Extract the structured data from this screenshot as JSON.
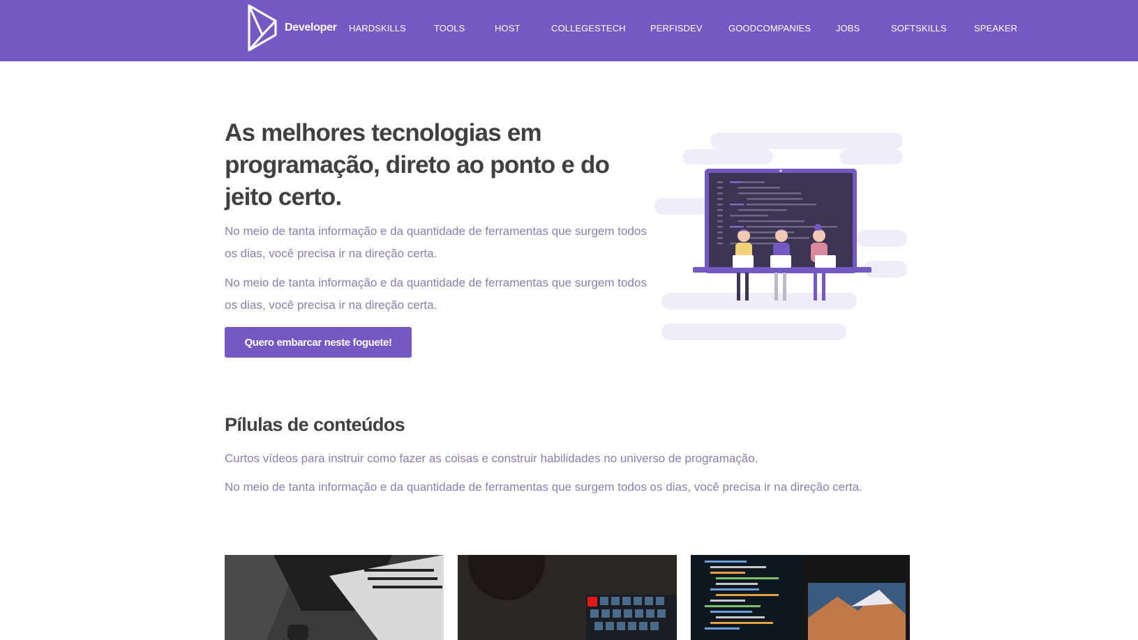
{
  "brand": {
    "name": "Developer"
  },
  "nav": {
    "items": [
      "HARDSKILLS",
      "TOOLS",
      "HOST",
      "COLLEGESTECH",
      "PERFISDEV",
      "GOODCOMPANIES",
      "JOBS",
      "SOFTSKILLS",
      "SPEAKER"
    ]
  },
  "hero": {
    "title": "As melhores tecnologias em programação, direto ao ponto e do jeito certo.",
    "paragraph1": "No meio de tanta informação e da quantidade de ferramentas que surgem todos os dias, você precisa ir na direção certa.",
    "paragraph2": "No meio de tanta informação e da quantidade de ferramentas que surgem todos os dias, você precisa ir na direção certa.",
    "cta_label": "Quero embarcar neste foguete!"
  },
  "pills": {
    "title": "Pílulas de conteúdos",
    "subtitle": "Curtos vídeos para instruir como fazer as coisas e construir habilidades no universo de programação.",
    "paragraph": "No meio de tanta informação e da quantidade de ferramentas que surgem todos os dias, você precisa ir na direção certa."
  },
  "cards": [
    {
      "icon": "laptop-photo"
    },
    {
      "icon": "keyboard-coffee-photo"
    },
    {
      "icon": "monitor-code-photo"
    }
  ],
  "colors": {
    "accent": "#7559c2",
    "text_muted": "#8a7fae",
    "heading": "#404040"
  }
}
